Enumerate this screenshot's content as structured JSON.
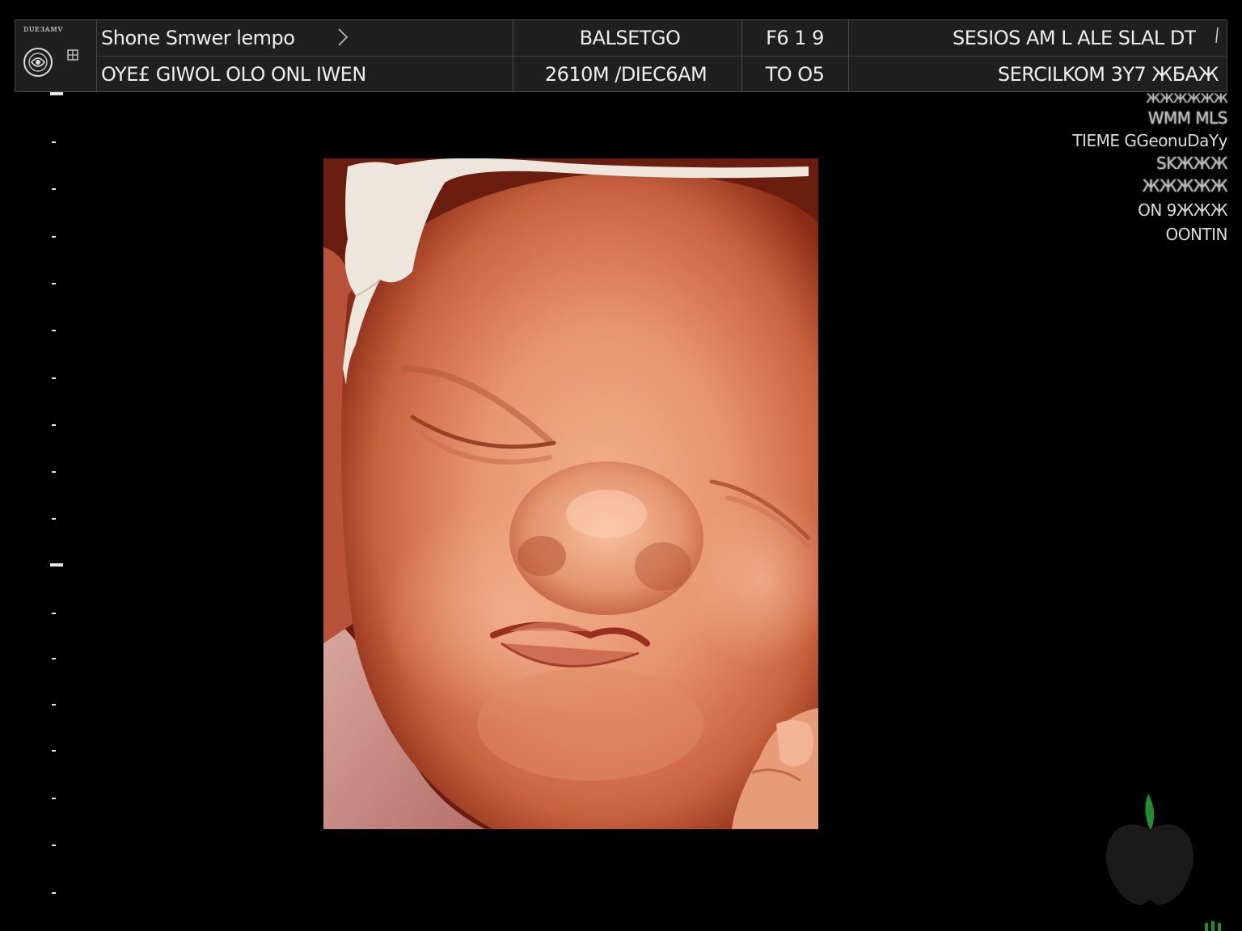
{
  "header": {
    "logo_text": "ᴅᴜᴇᴈᴀᴍᴠ",
    "row1": {
      "patient": "Shone Smwer lempo",
      "exam": "BALSETGO",
      "freq": "F6 1 9",
      "clinic": "SESIOS AM  L ALE SLAL DT"
    },
    "row2": {
      "info": "OYE£ GIWOL OLO ONL IWEN",
      "date": "2610M /DIEC6AM",
      "time": "TO O5",
      "mode": "SERCILKOM   3Y7 ЖБАЖ"
    }
  },
  "info_panel": {
    "lines": [
      "ЖЖЖЖЖЖ",
      "WMM MLS",
      "TIEME GGeonuDaYy",
      "SKЖЖЖ",
      "ЖЖЖЖЖ",
      "ON  9ЖЖЖ",
      "OONTIN"
    ]
  },
  "render": {
    "subject": "3D fetal face render",
    "skin_color": "#e79b78",
    "shadow_color": "#7a2412"
  },
  "watermark": {
    "shape": "apple-icon",
    "leaf_color": "#1f8f2f"
  },
  "colors": {
    "background": "#000000",
    "header_bg": "#1f1f1f",
    "text": "#eeeeee"
  }
}
